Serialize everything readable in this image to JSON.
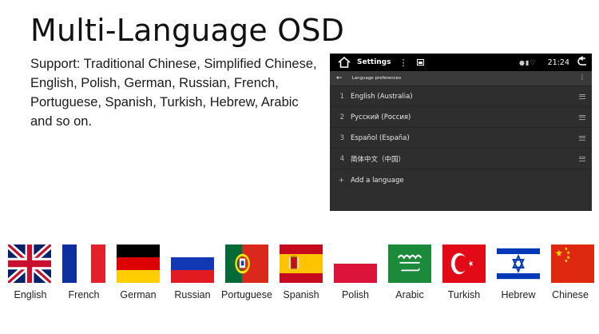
{
  "headline": "Multi-Language OSD",
  "support_text": "Support: Traditional Chinese, Simplified Chinese, English, Polish, German, Russian, French, Portuguese, Spanish, Turkish, Hebrew, Arabic and so on.",
  "device": {
    "status_bar": {
      "title": "Settings",
      "time": "21:24"
    },
    "app_bar": {
      "title": "Language preferences"
    },
    "languages": [
      {
        "num": "1",
        "name": "English (Australia)"
      },
      {
        "num": "2",
        "name": "Русский (Россия)"
      },
      {
        "num": "3",
        "name": "Español (España)"
      },
      {
        "num": "4",
        "name": "简体中文（中国）"
      }
    ],
    "add_language": {
      "plus": "+",
      "label": "Add a language"
    }
  },
  "flags": [
    {
      "name": "English",
      "icon": "uk-flag-icon"
    },
    {
      "name": "French",
      "icon": "france-flag-icon"
    },
    {
      "name": "German",
      "icon": "germany-flag-icon"
    },
    {
      "name": "Russian",
      "icon": "russia-flag-icon"
    },
    {
      "name": "Portuguese",
      "icon": "portugal-flag-icon"
    },
    {
      "name": "Spanish",
      "icon": "spain-flag-icon"
    },
    {
      "name": "Polish",
      "icon": "poland-flag-icon"
    },
    {
      "name": "Arabic",
      "icon": "saudi-arabia-flag-icon"
    },
    {
      "name": "Turkish",
      "icon": "turkey-flag-icon"
    },
    {
      "name": "Hebrew",
      "icon": "israel-flag-icon"
    },
    {
      "name": "Chinese",
      "icon": "china-flag-icon"
    }
  ],
  "colors": {
    "screen_bg": "#2e2e2e",
    "status_bar_bg": "#000000",
    "app_bar_bg": "#3a3a3a"
  }
}
